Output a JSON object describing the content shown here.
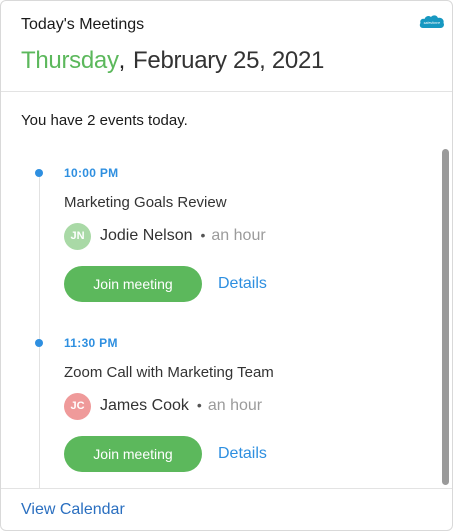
{
  "header": {
    "title": "Today's Meetings",
    "day": "Thursday",
    "comma": ",",
    "date": "February 25, 2021",
    "logo_text": "salesforce"
  },
  "summary": "You have 2 events today.",
  "events": [
    {
      "time": "10:00 PM",
      "title": "Marketing Goals Review",
      "attendee_initials": "JN",
      "attendee_name": "Jodie Nelson",
      "separator": "•",
      "duration": "an hour",
      "join_label": "Join meeting",
      "details_label": "Details"
    },
    {
      "time": "11:30 PM",
      "title": "Zoom Call with Marketing Team",
      "attendee_initials": "JC",
      "attendee_name": "James Cook",
      "separator": "•",
      "duration": "an hour",
      "join_label": "Join meeting",
      "details_label": "Details"
    }
  ],
  "footer": {
    "view_calendar": "View Calendar"
  },
  "colors": {
    "accent_green": "#5cb85c",
    "accent_blue": "#2e8fe0",
    "salesforce_blue": "#1798c1"
  }
}
